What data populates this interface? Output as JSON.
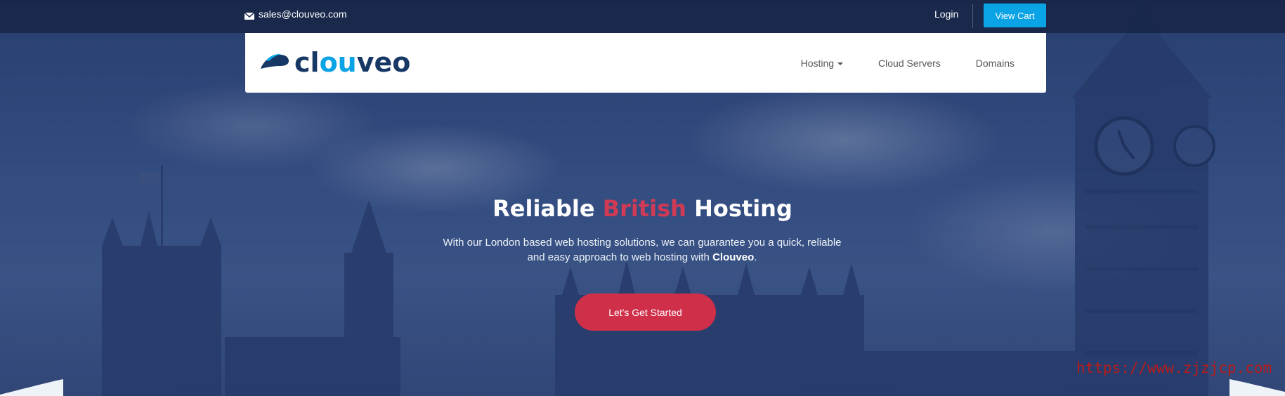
{
  "topbar": {
    "email": "sales@clouveo.com",
    "login_label": "Login",
    "cart_label": "View Cart"
  },
  "logo": {
    "part1": "cl",
    "part2": "ou",
    "part3": "veo"
  },
  "nav": {
    "items": [
      {
        "label": "Hosting",
        "has_dropdown": true
      },
      {
        "label": "Cloud Servers",
        "has_dropdown": false
      },
      {
        "label": "Domains",
        "has_dropdown": false
      }
    ]
  },
  "hero": {
    "title_before": "Reliable ",
    "title_accent": "British",
    "title_after": " Hosting",
    "desc_line1": "With our London based web hosting solutions, we can guarantee you a quick, reliable",
    "desc_line2_before": "and easy approach to web hosting with ",
    "desc_brand": "Clouveo",
    "desc_line2_after": ".",
    "cta_label": "Let's Get Started"
  },
  "watermark": "https://www.zjzjcp.com",
  "colors": {
    "accent_red": "#cf2f49",
    "brand_blue": "#0aa3e6",
    "brand_navy": "#173865"
  },
  "icons": {
    "email": "envelope-icon",
    "logo": "cloud-logo-icon",
    "dropdown": "caret-down-icon"
  }
}
